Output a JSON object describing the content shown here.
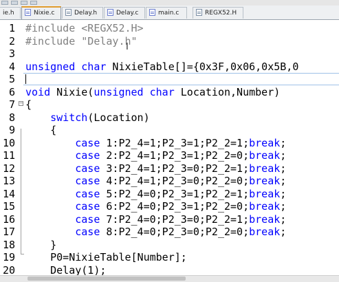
{
  "tabs": [
    {
      "label": "ie.h",
      "active": false,
      "type": "h"
    },
    {
      "label": "Nixie.c",
      "active": true,
      "type": "c"
    },
    {
      "label": "Delay.h",
      "active": false,
      "type": "h"
    },
    {
      "label": "Delay.c",
      "active": false,
      "type": "c"
    },
    {
      "label": "main.c",
      "active": false,
      "type": "c"
    },
    {
      "label": "REGX52.H",
      "active": false,
      "type": "h"
    }
  ],
  "editor": {
    "current_line": 5,
    "lines": [
      {
        "n": "1",
        "tokens": [
          {
            "t": "#include <REGX52.H>",
            "c": "pp"
          }
        ]
      },
      {
        "n": "2",
        "tokens": [
          {
            "t": "#include \"Delay.h\"",
            "c": "pp"
          }
        ]
      },
      {
        "n": "3",
        "tokens": []
      },
      {
        "n": "4",
        "tokens": [
          {
            "t": "unsigned char",
            "c": "kw"
          },
          {
            "t": " NixieTable[]={0x3F,0x06,0x5B,0",
            "c": "sy"
          }
        ]
      },
      {
        "n": "5",
        "tokens": []
      },
      {
        "n": "6",
        "tokens": [
          {
            "t": "void",
            "c": "kw"
          },
          {
            "t": " Nixie(",
            "c": "sy"
          },
          {
            "t": "unsigned char",
            "c": "kw"
          },
          {
            "t": " Location,Number)",
            "c": "sy"
          }
        ]
      },
      {
        "n": "7",
        "tokens": [
          {
            "t": "{",
            "c": "sy"
          }
        ]
      },
      {
        "n": "8",
        "tokens": [
          {
            "t": "    ",
            "c": "sy"
          },
          {
            "t": "switch",
            "c": "kw"
          },
          {
            "t": "(Location)",
            "c": "sy"
          }
        ]
      },
      {
        "n": "9",
        "tokens": [
          {
            "t": "    {",
            "c": "sy"
          }
        ]
      },
      {
        "n": "10",
        "tokens": [
          {
            "t": "        ",
            "c": "sy"
          },
          {
            "t": "case",
            "c": "kw"
          },
          {
            "t": " 1:P2_4=1;P2_3=1;P2_2=1;",
            "c": "sy"
          },
          {
            "t": "break",
            "c": "kw"
          },
          {
            "t": ";",
            "c": "sy"
          }
        ]
      },
      {
        "n": "11",
        "tokens": [
          {
            "t": "        ",
            "c": "sy"
          },
          {
            "t": "case",
            "c": "kw"
          },
          {
            "t": " 2:P2_4=1;P2_3=1;P2_2=0;",
            "c": "sy"
          },
          {
            "t": "break",
            "c": "kw"
          },
          {
            "t": ";",
            "c": "sy"
          }
        ]
      },
      {
        "n": "12",
        "tokens": [
          {
            "t": "        ",
            "c": "sy"
          },
          {
            "t": "case",
            "c": "kw"
          },
          {
            "t": " 3:P2_4=1;P2_3=0;P2_2=1;",
            "c": "sy"
          },
          {
            "t": "break",
            "c": "kw"
          },
          {
            "t": ";",
            "c": "sy"
          }
        ]
      },
      {
        "n": "13",
        "tokens": [
          {
            "t": "        ",
            "c": "sy"
          },
          {
            "t": "case",
            "c": "kw"
          },
          {
            "t": " 4:P2_4=1;P2_3=0;P2_2=0;",
            "c": "sy"
          },
          {
            "t": "break",
            "c": "kw"
          },
          {
            "t": ";",
            "c": "sy"
          }
        ]
      },
      {
        "n": "14",
        "tokens": [
          {
            "t": "        ",
            "c": "sy"
          },
          {
            "t": "case",
            "c": "kw"
          },
          {
            "t": " 5:P2_4=0;P2_3=1;P2_2=1;",
            "c": "sy"
          },
          {
            "t": "break",
            "c": "kw"
          },
          {
            "t": ";",
            "c": "sy"
          }
        ]
      },
      {
        "n": "15",
        "tokens": [
          {
            "t": "        ",
            "c": "sy"
          },
          {
            "t": "case",
            "c": "kw"
          },
          {
            "t": " 6:P2_4=0;P2_3=1;P2_2=0;",
            "c": "sy"
          },
          {
            "t": "break",
            "c": "kw"
          },
          {
            "t": ";",
            "c": "sy"
          }
        ]
      },
      {
        "n": "16",
        "tokens": [
          {
            "t": "        ",
            "c": "sy"
          },
          {
            "t": "case",
            "c": "kw"
          },
          {
            "t": " 7:P2_4=0;P2_3=0;P2_2=1;",
            "c": "sy"
          },
          {
            "t": "break",
            "c": "kw"
          },
          {
            "t": ";",
            "c": "sy"
          }
        ]
      },
      {
        "n": "17",
        "tokens": [
          {
            "t": "        ",
            "c": "sy"
          },
          {
            "t": "case",
            "c": "kw"
          },
          {
            "t": " 8:P2_4=0;P2_3=0;P2_2=0;",
            "c": "sy"
          },
          {
            "t": "break",
            "c": "kw"
          },
          {
            "t": ";",
            "c": "sy"
          }
        ]
      },
      {
        "n": "18",
        "tokens": [
          {
            "t": "    }",
            "c": "sy"
          }
        ]
      },
      {
        "n": "19",
        "tokens": [
          {
            "t": "    P0=NixieTable[Number];",
            "c": "sy"
          }
        ]
      },
      {
        "n": "20",
        "tokens": [
          {
            "t": "    Delay(1);",
            "c": "sy"
          }
        ]
      }
    ]
  },
  "colors": {
    "keyword": "#0000ff",
    "preprocessor": "#808080",
    "text": "#000000",
    "active_tab_accent": "#e09a2c",
    "current_line_border": "#9fc1e8"
  },
  "icons": {
    "mouse": "i-beam-cursor-icon",
    "fold_open": "fold-minus-icon"
  }
}
